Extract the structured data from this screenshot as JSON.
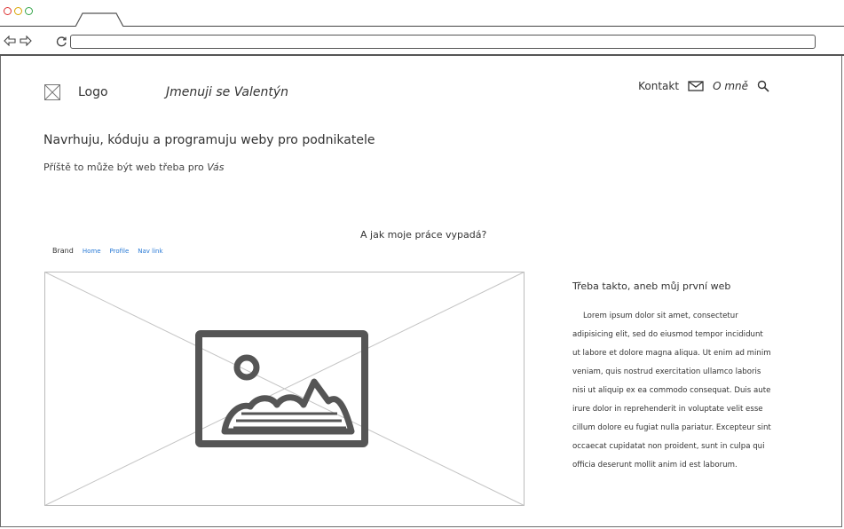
{
  "browser": {
    "url": ""
  },
  "header": {
    "logo_label": "Logo",
    "site_name": "Jmenuji se Valentýn",
    "nav": {
      "contact": "Kontakt",
      "about": "O mně"
    }
  },
  "hero": {
    "headline": "Navrhuju, kóduju a programuju weby pro podnikatele",
    "subline_prefix": "Příště to může být web třeba pro ",
    "subline_emphasis": "Vás"
  },
  "portfolio": {
    "section_title": "A jak moje práce vypadá?",
    "mini_tabs": {
      "brand": "Brand",
      "items": [
        "Home",
        "Profile",
        "Nav link"
      ]
    },
    "side_title": "Třeba takto, aneb můj první web",
    "side_text": "Lorem ipsum dolor sit amet, consectetur adipisicing elit, sed do eiusmod tempor incididunt ut labore et dolore magna aliqua. Ut enim ad minim veniam, quis nostrud exercitation ullamco laboris nisi ut aliquip ex ea commodo consequat. Duis aute irure dolor in reprehenderit in voluptate velit esse cillum dolore eu fugiat nulla pariatur. Excepteur sint occaecat cupidatat non proident, sunt in culpa qui officia deserunt mollit anim id est laborum."
  },
  "icons": {
    "back": "arrow-left-icon",
    "forward": "arrow-right-icon",
    "reload": "reload-icon",
    "mail": "envelope-icon",
    "search": "magnifier-icon",
    "logo": "image-placeholder-icon"
  },
  "colors": {
    "window_top_border": "#3f8f2d",
    "link_blue": "#2b7bd6",
    "dot_red": "#d33",
    "dot_yellow": "#d9a400",
    "dot_green": "#35a54a"
  }
}
